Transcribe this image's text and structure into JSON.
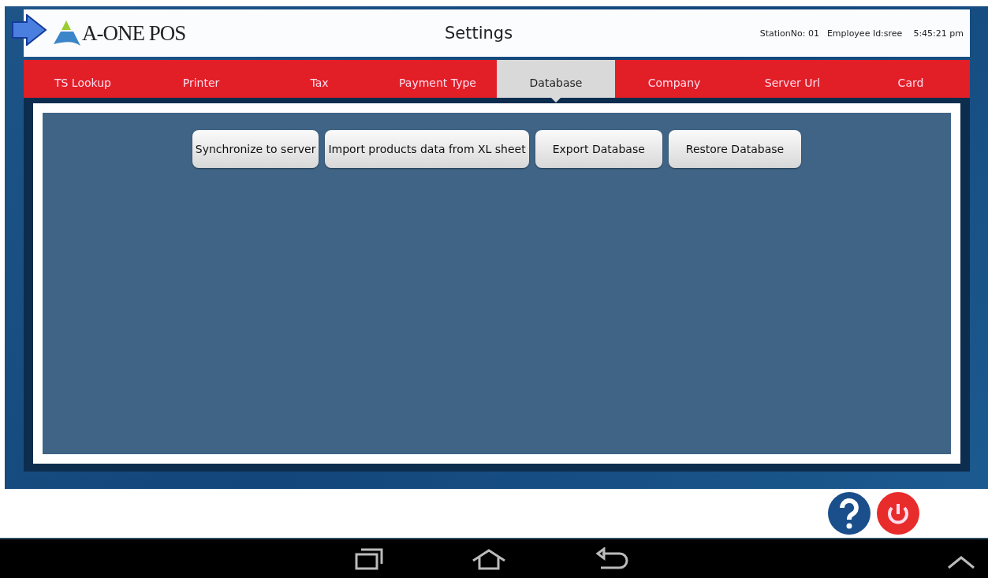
{
  "header": {
    "logo_text": "A-ONE POS",
    "title": "Settings",
    "station": "StationNo: 01",
    "employee": "Employee Id:sree",
    "time": "5:45:21 pm"
  },
  "tabs": [
    {
      "label": "TS Lookup",
      "selected": false
    },
    {
      "label": "Printer",
      "selected": false
    },
    {
      "label": "Tax",
      "selected": false
    },
    {
      "label": "Payment Type",
      "selected": false
    },
    {
      "label": "Database",
      "selected": true
    },
    {
      "label": "Company",
      "selected": false
    },
    {
      "label": "Server Url",
      "selected": false
    },
    {
      "label": "Card",
      "selected": false
    }
  ],
  "actions": [
    "Synchronize to server",
    "Import products data from XL sheet",
    "Export Database",
    "Restore Database"
  ]
}
